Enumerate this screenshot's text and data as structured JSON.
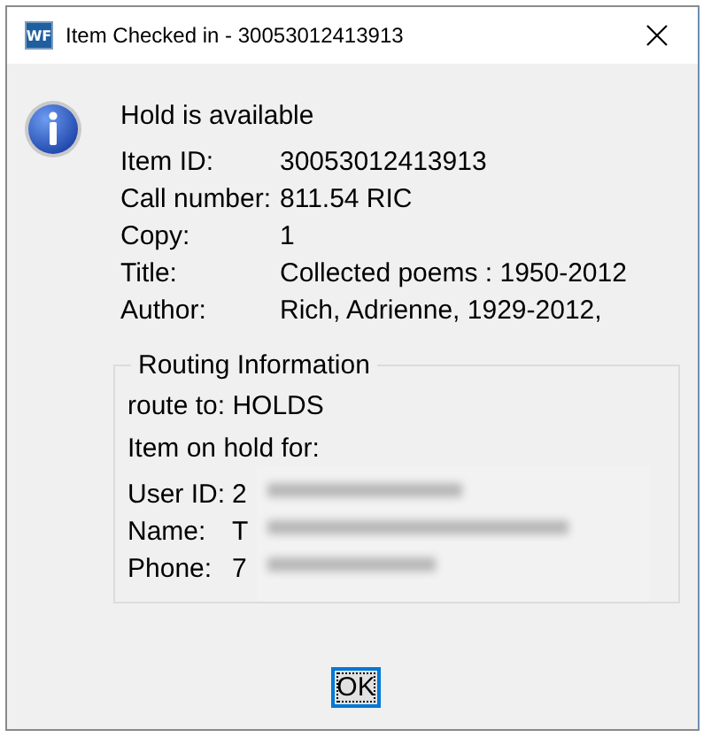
{
  "window": {
    "title": "Item Checked in - 30053012413913",
    "app_icon": "WF"
  },
  "message": "Hold is available",
  "details": [
    {
      "label": "Item ID:",
      "value": "30053012413913"
    },
    {
      "label": "Call number:",
      "value": "811.54 RIC"
    },
    {
      "label": "Copy:",
      "value": "1"
    },
    {
      "label": "Title:",
      "value": "Collected poems : 1950-2012"
    },
    {
      "label": "Author:",
      "value": "Rich, Adrienne, 1929-2012,"
    }
  ],
  "routing": {
    "title": "Routing Information",
    "route": "route to: HOLDS",
    "hold_for": "Item on hold for:",
    "fields": [
      {
        "label": "User ID:",
        "value": "2"
      },
      {
        "label": "Name:",
        "value": "T"
      },
      {
        "label": "Phone:",
        "value": "7"
      }
    ]
  },
  "buttons": [
    "OK"
  ]
}
